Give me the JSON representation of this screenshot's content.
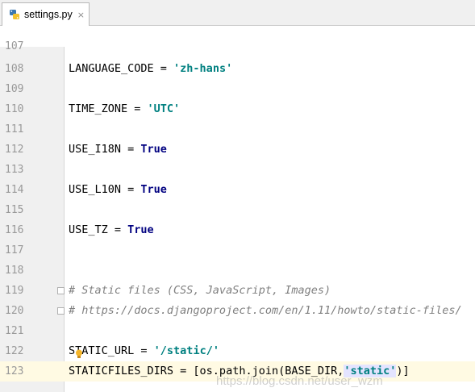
{
  "tabs": [
    {
      "label": "settings.py",
      "icon": "python-file-icon",
      "close": "×"
    }
  ],
  "editor": {
    "partial_top_line": "107",
    "lines": [
      {
        "num": "108",
        "parts": [
          {
            "t": "LANGUAGE_CODE = "
          },
          {
            "t": "'zh-hans'",
            "c": "str"
          }
        ]
      },
      {
        "num": "109",
        "parts": []
      },
      {
        "num": "110",
        "parts": [
          {
            "t": "TIME_ZONE = "
          },
          {
            "t": "'UTC'",
            "c": "str"
          }
        ]
      },
      {
        "num": "111",
        "parts": []
      },
      {
        "num": "112",
        "parts": [
          {
            "t": "USE_I18N = "
          },
          {
            "t": "True",
            "c": "kw"
          }
        ]
      },
      {
        "num": "113",
        "parts": []
      },
      {
        "num": "114",
        "parts": [
          {
            "t": "USE_L10N = "
          },
          {
            "t": "True",
            "c": "kw"
          }
        ]
      },
      {
        "num": "115",
        "parts": []
      },
      {
        "num": "116",
        "parts": [
          {
            "t": "USE_TZ = "
          },
          {
            "t": "True",
            "c": "kw"
          }
        ]
      },
      {
        "num": "117",
        "parts": []
      },
      {
        "num": "118",
        "parts": []
      },
      {
        "num": "119",
        "comment": true,
        "fold": true,
        "parts": [
          {
            "t": "# Static files (CSS, JavaScript, Images)"
          }
        ]
      },
      {
        "num": "120",
        "comment": true,
        "fold": true,
        "parts": [
          {
            "t": "# https://docs.djangoproject.com/en/1.11/howto/static-files/"
          }
        ]
      },
      {
        "num": "121",
        "parts": []
      },
      {
        "num": "122",
        "bulb": true,
        "parts": [
          {
            "t": "STATIC_URL = "
          },
          {
            "t": "'/static/'",
            "c": "str"
          }
        ]
      },
      {
        "num": "123",
        "current": true,
        "parts": [
          {
            "t": "STATICFILES_DIRS = [os.path.join(BASE_DIR,"
          },
          {
            "t": "'static'",
            "c": "str hl"
          },
          {
            "t": ")]"
          }
        ]
      }
    ]
  },
  "watermark": "https://blog.csdn.net/user_wzm",
  "colors": {
    "string": "#008080",
    "keyword": "#000080",
    "comment": "#808080",
    "line_number": "#999999",
    "current_line": "#fffae3",
    "gutter": "#f0f0f0"
  }
}
